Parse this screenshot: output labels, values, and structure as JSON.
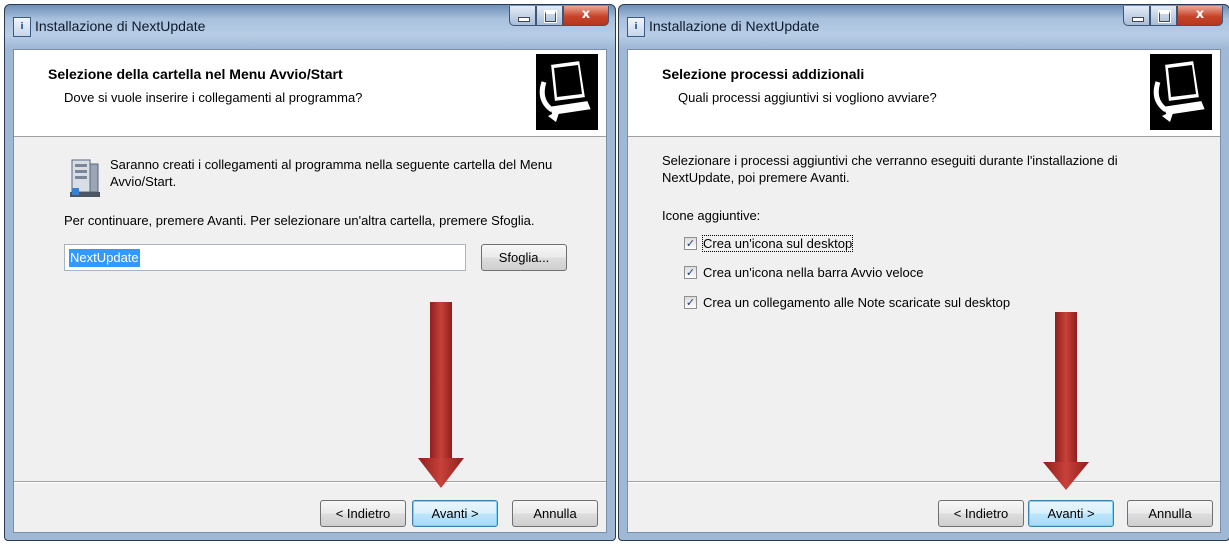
{
  "left_window": {
    "title": "Installazione di NextUpdate",
    "close_label": "x",
    "header_title": "Selezione della cartella nel Menu Avvio/Start",
    "header_subtitle": "Dove si vuole inserire i collegamenti al programma?",
    "info_line1": "Saranno creati i collegamenti al programma nella seguente cartella del Menu",
    "info_line2": "Avvio/Start.",
    "instruction": "Per continuare, premere Avanti. Per selezionare un'altra cartella, premere Sfoglia.",
    "folder_value": "NextUpdate",
    "browse_label": "Sfoglia...",
    "back_label": "< Indietro",
    "next_label": "Avanti >",
    "cancel_label": "Annulla"
  },
  "right_window": {
    "title": "Installazione di NextUpdate",
    "close_label": "x",
    "header_title": "Selezione processi addizionali",
    "header_subtitle": "Quali processi aggiuntivi si vogliono avviare?",
    "desc_line1": "Selezionare i processi aggiuntivi che verranno eseguiti durante l'installazione di",
    "desc_line2": "NextUpdate, poi premere Avanti.",
    "group_label": "Icone aggiuntive:",
    "checkboxes": [
      {
        "label": "Crea un'icona sul desktop",
        "checked": true
      },
      {
        "label": "Crea un'icona nella barra Avvio veloce",
        "checked": true
      },
      {
        "label": "Crea un collegamento alle Note scaricate sul desktop",
        "checked": true
      }
    ],
    "back_label": "< Indietro",
    "next_label": "Avanti >",
    "cancel_label": "Annulla"
  },
  "colors": {
    "arrow": "#b8312c",
    "selection": "#3399ff",
    "default_button_border": "#3c7fb1"
  }
}
